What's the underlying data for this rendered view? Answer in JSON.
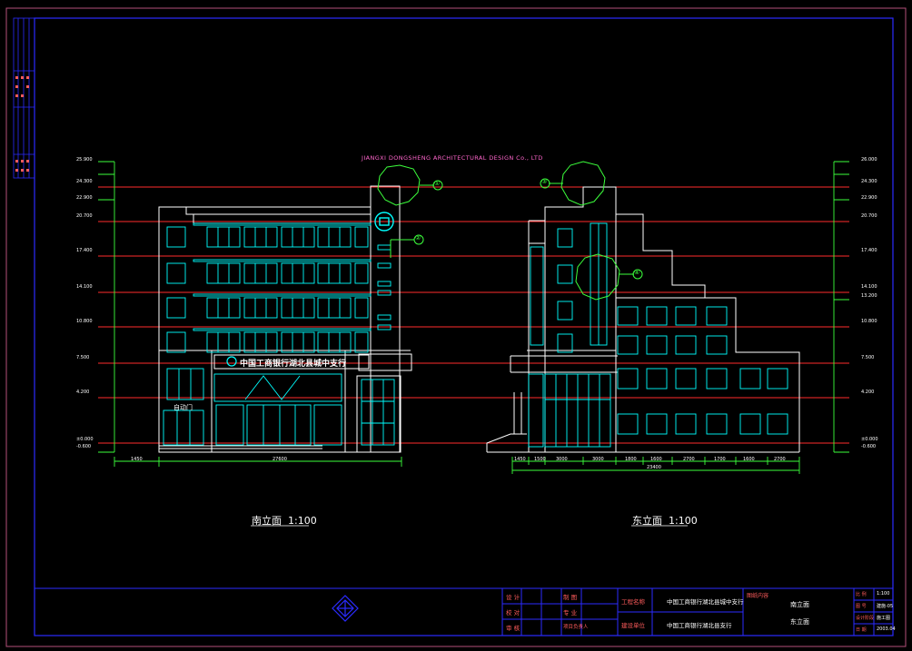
{
  "drawing": {
    "company_banner": "JIANGXI DONGSHENG ARCHITECTURAL DESIGN Co., LTD",
    "south_title": "南立面  1:100",
    "east_title": "东立面  1:100",
    "sign_text": "中国工商银行湖北县城中支行",
    "gate_label": "自动门",
    "callouts": [
      "①",
      "②",
      "③",
      "④"
    ]
  },
  "levels_left": [
    "25.900",
    "24.300",
    "22.900",
    "20.700",
    "17.400",
    "14.100",
    "10.800",
    "7.500",
    "4.200",
    "±0.000",
    "-0.600"
  ],
  "levels_right": [
    "26.000",
    "24.300",
    "22.900",
    "20.700",
    "17.400",
    "14.100",
    "13.200",
    "10.800",
    "7.500",
    "4.200",
    "±0.000",
    "-0.600"
  ],
  "dims_south": [
    "1450",
    "27600"
  ],
  "dims_east": [
    "1450",
    "1500",
    "3000",
    "3000",
    "1800",
    "1600",
    "2700",
    "1700",
    "1600",
    "2700",
    "23400"
  ],
  "title_block": {
    "left_roles": [
      "设 计",
      "校 对",
      "审 核"
    ],
    "mid_roles": [
      "制 图",
      "专 业",
      "项目负责人"
    ],
    "project_label": "工程名称",
    "client_label": "建设单位",
    "project_name": "中国工商银行湖北县城中支行",
    "client_name": "中国工商银行湖北县支行",
    "sheet_label": "图纸内容",
    "sheet_content": [
      "南立面",
      "东立面"
    ],
    "right_fields": [
      "比 例",
      "图 号",
      "设计阶段",
      "日 期"
    ],
    "right_values": [
      "1:100",
      "建施-05",
      "施工图",
      "2003.04"
    ]
  },
  "side_strip": [
    "会",
    "签",
    "栏"
  ]
}
